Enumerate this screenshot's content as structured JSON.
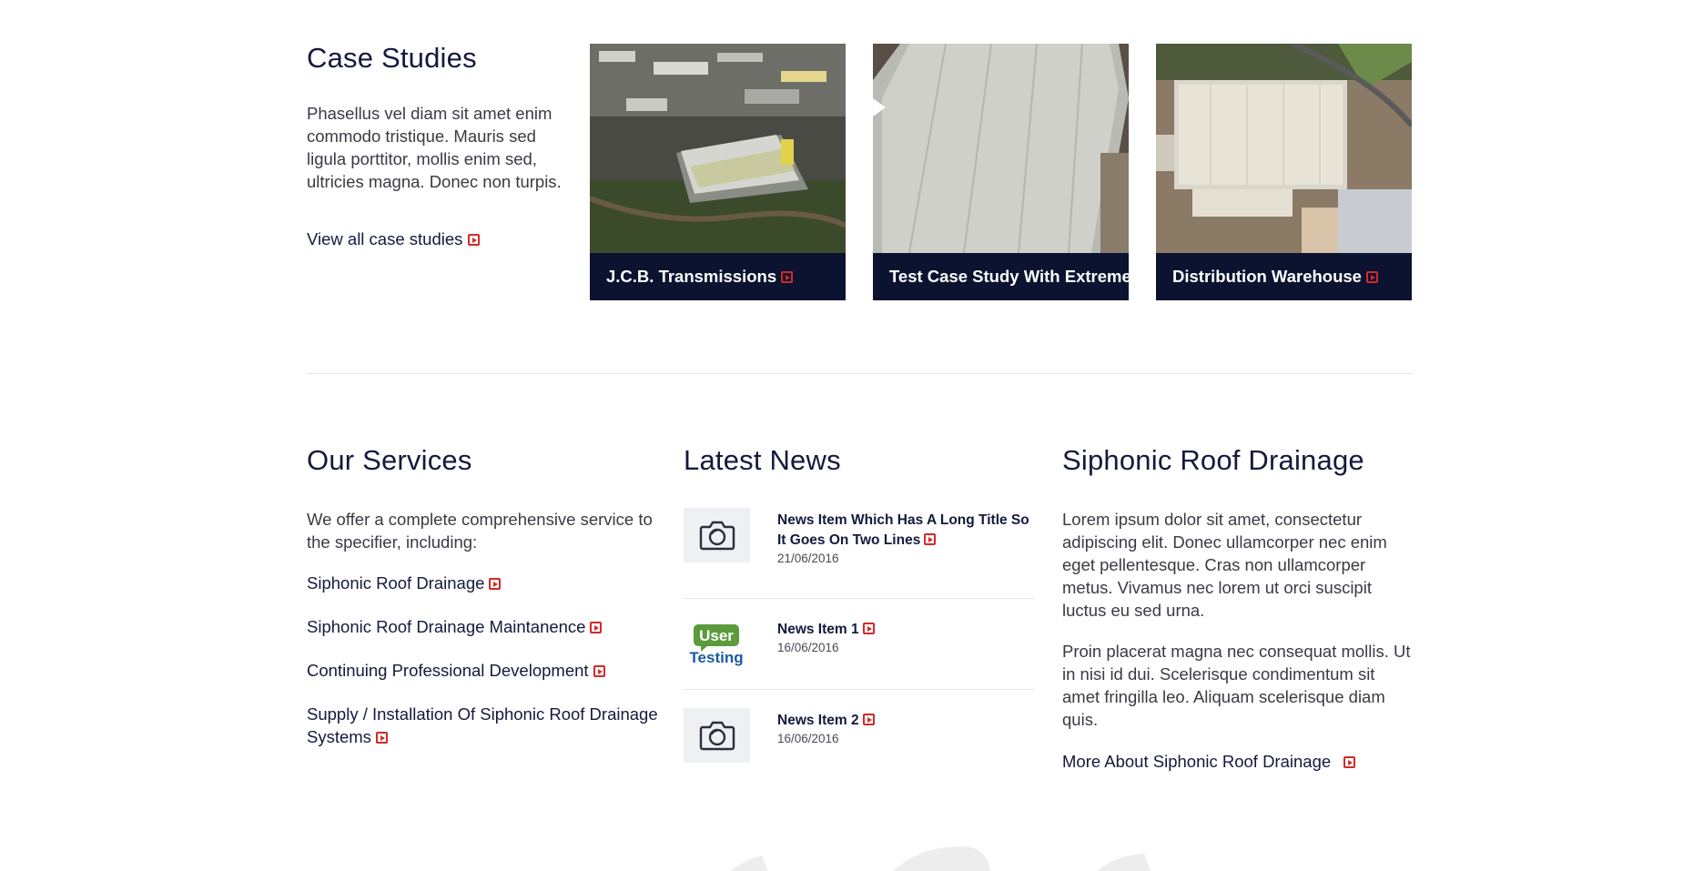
{
  "case_studies": {
    "title": "Case Studies",
    "description": "Phasellus vel diam sit amet enim commodo tristique. Mauris sed ligula porttitor, mollis enim sed, ultricies magna. Donec non turpis.",
    "view_all_label": "View all case studies",
    "cards": [
      {
        "title": "J.C.B. Transmissions"
      },
      {
        "title": "Test Case Study With Extreme Name"
      },
      {
        "title": "Distribution Warehouse"
      }
    ]
  },
  "services": {
    "title": "Our Services",
    "intro": "We offer a complete comprehensive service to the specifier, including:",
    "items": [
      "Siphonic Roof Drainage",
      "Siphonic Roof Drainage Maintanence",
      "Continuing Professional Development",
      "Supply / Installation Of Siphonic Roof Drainage Systems"
    ]
  },
  "news": {
    "title": "Latest News",
    "items": [
      {
        "title": "News Item Which Has A Long Title So It Goes On Two Lines",
        "date": "21/06/2016",
        "thumb": "camera-icon"
      },
      {
        "title": "News Item 1",
        "date": "16/06/2016",
        "thumb": "user-testing-logo",
        "logo_text_1": "User",
        "logo_text_2": "Testing"
      },
      {
        "title": "News Item 2",
        "date": "16/06/2016",
        "thumb": "camera-icon"
      }
    ]
  },
  "siphonic": {
    "title": "Siphonic Roof Drainage",
    "para1": "Lorem ipsum dolor sit amet, consectetur adipiscing elit. Donec ullamcorper nec enim eget pellentesque. Cras non ullamcorper metus. Vivamus nec lorem ut orci suscipit luctus eu sed urna.",
    "para2": "Proin placerat magna nec consequat mollis. Ut in nisi id dui. Scelerisque condimentum sit amet fringilla leo. Aliquam scelerisque diam quis.",
    "more_label": "More About Siphonic Roof Drainage"
  },
  "colors": {
    "heading": "#141a3c",
    "card_bar": "#0b1330",
    "accent_red": "#d12a2a",
    "logo_green": "#5b9b3c",
    "logo_blue": "#1e5aa0"
  }
}
